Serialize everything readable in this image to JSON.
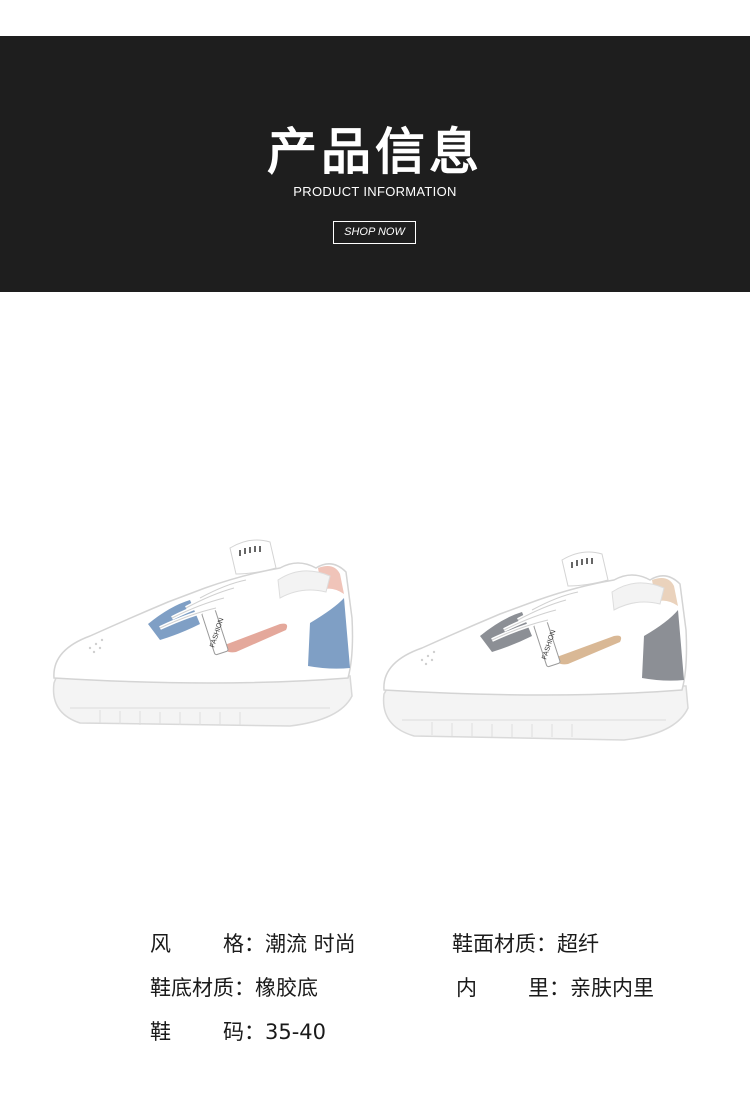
{
  "banner": {
    "title": "产品信息",
    "subtitle": "PRODUCT INFORMATION",
    "button_label": "SHOP NOW",
    "background_color": "#1e1e1e"
  },
  "products": {
    "left_shoe": {
      "tag_text": "FASHION",
      "accent_colors": [
        "#7f9fc5",
        "#e4a89b"
      ]
    },
    "right_shoe": {
      "tag_text": "FASHION",
      "accent_colors": [
        "#8c8f95",
        "#d9b895"
      ]
    }
  },
  "specs": [
    {
      "label_a": "风",
      "label_b": "格",
      "separator": "：",
      "value": "潮流 时尚"
    },
    {
      "label": "鞋面材质",
      "separator": "：",
      "value": "超纤"
    },
    {
      "label": "鞋底材质",
      "separator": "：",
      "value": "橡胶底"
    },
    {
      "label_a": "内",
      "label_b": "里",
      "separator": "：",
      "value": "亲肤内里"
    },
    {
      "label_a": "鞋",
      "label_b": "码",
      "separator": "：",
      "value": "35-40"
    }
  ]
}
